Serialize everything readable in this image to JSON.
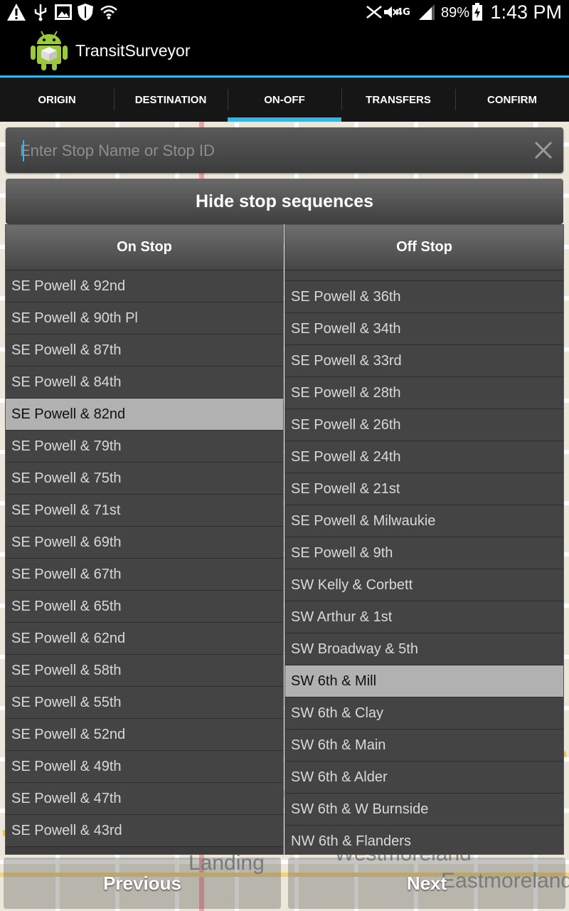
{
  "status_bar": {
    "battery_percent": "89%",
    "time": "1:43 PM",
    "network_label": "4G",
    "icons": [
      "warning-icon",
      "usb-icon",
      "image-icon",
      "shield-icon",
      "wifi-icon",
      "nfc-icon",
      "mute-icon",
      "signal-icon",
      "battery-charging-icon"
    ]
  },
  "app": {
    "title": "TransitSurveyor",
    "accent_color": "#33b5e5"
  },
  "tabs": [
    {
      "label": "ORIGIN",
      "active": false
    },
    {
      "label": "DESTINATION",
      "active": false
    },
    {
      "label": "ON-OFF",
      "active": true
    },
    {
      "label": "TRANSFERS",
      "active": false
    },
    {
      "label": "CONFIRM",
      "active": false
    }
  ],
  "search": {
    "placeholder": "Enter Stop Name or Stop ID",
    "value": ""
  },
  "hide_sequences_label": "Hide stop sequences",
  "on_stop": {
    "header": "On Stop",
    "selected": "SE Powell & 82nd",
    "items": [
      "SE Powell & 92nd",
      "SE Powell & 90th Pl",
      "SE Powell & 87th",
      "SE Powell & 84th",
      "SE Powell & 82nd",
      "SE Powell & 79th",
      "SE Powell & 75th",
      "SE Powell & 71st",
      "SE Powell & 69th",
      "SE Powell & 67th",
      "SE Powell & 65th",
      "SE Powell & 62nd",
      "SE Powell & 58th",
      "SE Powell & 55th",
      "SE Powell & 52nd",
      "SE Powell & 49th",
      "SE Powell & 47th",
      "SE Powell & 43rd"
    ]
  },
  "off_stop": {
    "header": "Off Stop",
    "selected": "SW 6th & Mill",
    "items": [
      "SE Powell & 36th",
      "SE Powell & 34th",
      "SE Powell & 33rd",
      "SE Powell & 28th",
      "SE Powell & 26th",
      "SE Powell & 24th",
      "SE Powell & 21st",
      "SE Powell & Milwaukie",
      "SE Powell & 9th",
      "SW Kelly & Corbett",
      "SW Arthur & 1st",
      "SW Broadway & 5th",
      "SW 6th & Mill",
      "SW 6th & Clay",
      "SW 6th & Main",
      "SW 6th & Alder",
      "SW 6th & W Burnside",
      "NW 6th & Flanders"
    ]
  },
  "map_labels": [
    "Landing",
    "Westmoreland",
    "Eastmoreland"
  ],
  "buttons": {
    "previous": "Previous",
    "next": "Next"
  }
}
